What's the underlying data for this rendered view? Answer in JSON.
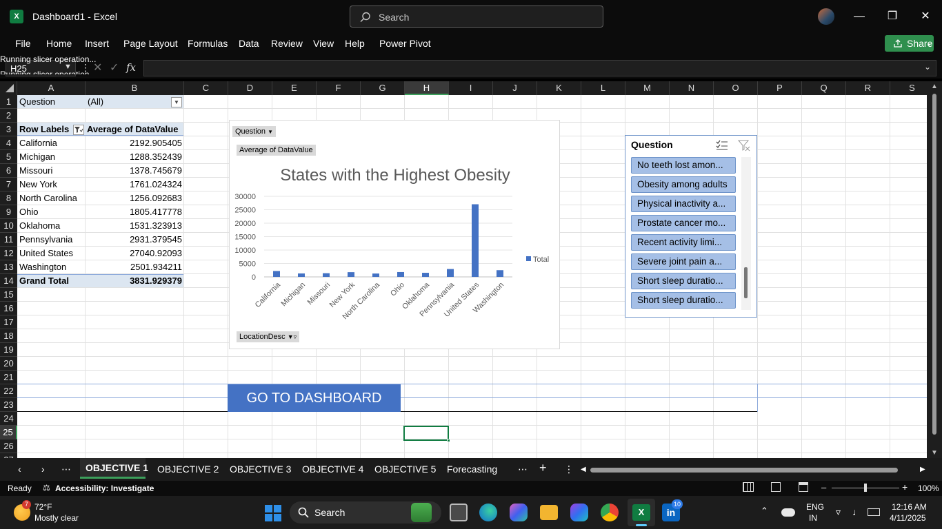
{
  "window": {
    "title": "Dashboard1 - Excel",
    "search_placeholder": "Search"
  },
  "ribbon": {
    "tabs": [
      "File",
      "Home",
      "Insert",
      "Page Layout",
      "Formulas",
      "Data",
      "Review",
      "View",
      "Help",
      "Power Pivot"
    ],
    "share_label": "Share"
  },
  "formula_bar": {
    "name_box": "H25",
    "fx": "fx",
    "formula": ""
  },
  "status_overlay": [
    "Running slicer operation...",
    "Running slicer operation..."
  ],
  "columns": [
    "A",
    "B",
    "C",
    "D",
    "E",
    "F",
    "G",
    "H",
    "I",
    "J",
    "K",
    "L",
    "M",
    "N",
    "O",
    "P",
    "Q",
    "R",
    "S"
  ],
  "selected_column": "H",
  "rows": [
    "1",
    "2",
    "3",
    "4",
    "5",
    "6",
    "7",
    "8",
    "9",
    "10",
    "11",
    "12",
    "13",
    "14",
    "15",
    "16",
    "17",
    "18",
    "19",
    "20",
    "21",
    "22",
    "23",
    "24",
    "25",
    "26",
    "27"
  ],
  "selected_row": "25",
  "pivot": {
    "filter_label": "Question",
    "filter_value": "(All)",
    "row_labels_header": "Row Labels",
    "value_header": "Average of DataValue",
    "rows": [
      {
        "label": "California",
        "value": "2192.905405"
      },
      {
        "label": "Michigan",
        "value": "1288.352439"
      },
      {
        "label": "Missouri",
        "value": "1378.745679"
      },
      {
        "label": "New York",
        "value": "1761.024324"
      },
      {
        "label": "North Carolina",
        "value": "1256.092683"
      },
      {
        "label": "Ohio",
        "value": "1805.417778"
      },
      {
        "label": "Oklahoma",
        "value": "1531.323913"
      },
      {
        "label": "Pennsylvania",
        "value": "2931.379545"
      },
      {
        "label": "United States",
        "value": "27040.92093"
      },
      {
        "label": "Washington",
        "value": "2501.934211"
      }
    ],
    "grand_total_label": "Grand Total",
    "grand_total_value": "3831.929379"
  },
  "chart_buttons": {
    "question": "Question",
    "value": "Average of DataValue",
    "location": "LocationDesc"
  },
  "chart_data": {
    "type": "bar",
    "title": "States with the Highest Obesity",
    "categories": [
      "California",
      "Michigan",
      "Missouri",
      "New York",
      "North Carolina",
      "Ohio",
      "Oklahoma",
      "Pennsylvania",
      "United States",
      "Washington"
    ],
    "series": [
      {
        "name": "Total",
        "values": [
          2192.905405,
          1288.352439,
          1378.745679,
          1761.024324,
          1256.092683,
          1805.417778,
          1531.323913,
          2931.379545,
          27040.92093,
          2501.934211
        ]
      }
    ],
    "yticks": [
      "0",
      "5000",
      "10000",
      "15000",
      "20000",
      "25000",
      "30000"
    ],
    "ylim": [
      0,
      30000
    ],
    "legend": "right",
    "grid": true,
    "bar_color": "#4472c4"
  },
  "slicer": {
    "title": "Question",
    "items": [
      "No teeth lost amon...",
      "Obesity among adults",
      "Physical inactivity a...",
      "Prostate cancer mo...",
      "Recent activity limi...",
      "Severe joint pain a...",
      "Short sleep duratio...",
      "Short sleep duratio..."
    ]
  },
  "go_button": "GO TO DASHBOARD",
  "sheet_tabs": [
    "OBJECTIVE 1",
    "OBJECTIVE 2",
    "OBJECTIVE 3",
    "OBJECTIVE 4",
    "OBJECTIVE 5",
    "Forecasting"
  ],
  "active_sheet": "OBJECTIVE 1",
  "status": {
    "ready": "Ready",
    "accessibility": "Accessibility: Investigate",
    "zoom": "100%"
  },
  "taskbar": {
    "weather_temp": "72°F",
    "weather_desc": "Mostly clear",
    "weather_badge": "7",
    "search": "Search",
    "lang1": "ENG",
    "lang2": "IN",
    "time": "12:16 AM",
    "date": "4/11/2025",
    "linkedin_badge": "10"
  }
}
